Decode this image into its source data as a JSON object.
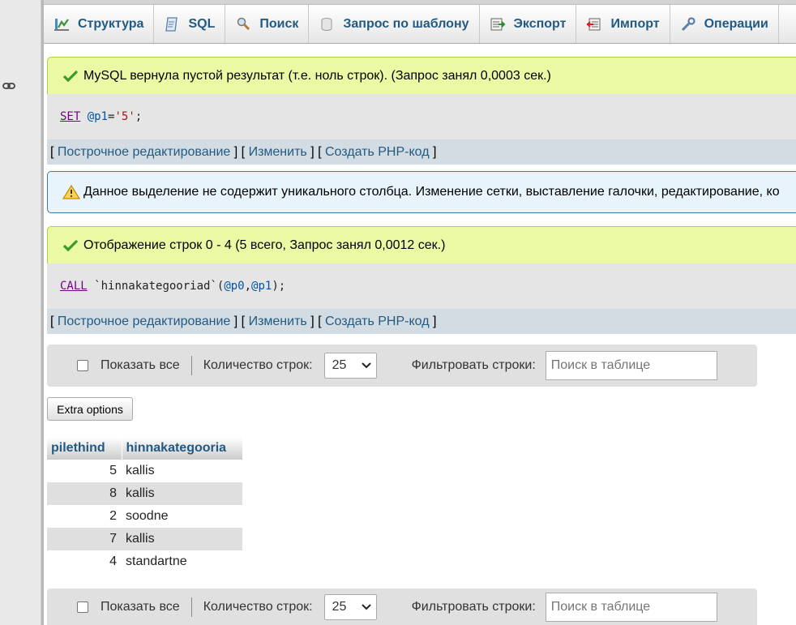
{
  "tabs": [
    {
      "label": "Структура",
      "icon": "structure-icon"
    },
    {
      "label": "SQL",
      "icon": "sql-icon"
    },
    {
      "label": "Поиск",
      "icon": "search-icon"
    },
    {
      "label": "Запрос по шаблону",
      "icon": "query-icon"
    },
    {
      "label": "Экспорт",
      "icon": "export-icon"
    },
    {
      "label": "Импорт",
      "icon": "import-icon"
    },
    {
      "label": "Операции",
      "icon": "operations-icon"
    }
  ],
  "result1": {
    "message": "MySQL вернула пустой результат (т.е. ноль строк). (Запрос занял 0,0003 сек.)",
    "sql": {
      "kw": "SET",
      "var": "@p1",
      "eq": "=",
      "str": "'5'",
      "end": ";"
    }
  },
  "result_links": {
    "open": "[",
    "inline_edit": "Построчное редактирование",
    "mid": "] [",
    "edit": "Изменить",
    "create_php": "Создать PHP-код",
    "close": "]"
  },
  "notice": {
    "message": "Данное выделение не содержит уникального столбца. Изменение сетки, выставление галочки, редактирование, ко"
  },
  "result2": {
    "message": "Отображение строк 0 - 4 (5 всего, Запрос занял 0,0012 сек.)",
    "sql": {
      "kw": "CALL",
      "proc": "`hinnakategooriad`",
      "open": "(",
      "p0": "@p0",
      "comma": ", ",
      "p1": "@p1",
      "close": ");"
    }
  },
  "navigation": {
    "show_all": "Показать все",
    "rows_label": "Количество строк:",
    "rows_value": "25",
    "filter_label": "Фильтровать строки:",
    "filter_placeholder": "Поиск в таблице"
  },
  "extra_options": "Extra options",
  "table": {
    "headers": [
      "pilethind",
      "hinnakategooria"
    ],
    "rows": [
      [
        "5",
        "kallis"
      ],
      [
        "8",
        "kallis"
      ],
      [
        "2",
        "soodne"
      ],
      [
        "7",
        "kallis"
      ],
      [
        "4",
        "standartne"
      ]
    ]
  },
  "colors": {
    "link": "#235a81",
    "success_bg": "#ebf8a4",
    "notice_bg": "#e7f4fb",
    "sql_keyword": "#770088"
  }
}
